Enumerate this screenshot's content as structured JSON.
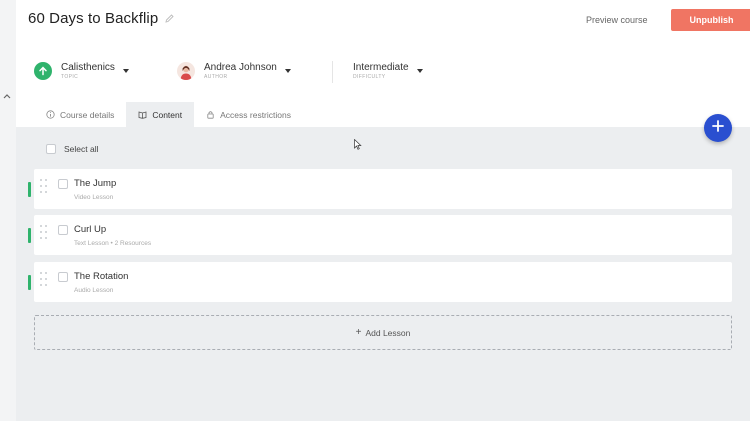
{
  "header": {
    "title": "60 Days to Backflip",
    "preview_label": "Preview course",
    "unpublish_label": "Unpublish"
  },
  "meta": {
    "topic": {
      "value": "Calisthenics",
      "label": "TOPIC"
    },
    "author": {
      "value": "Andrea Johnson",
      "label": "AUTHOR"
    },
    "difficulty": {
      "value": "Intermediate",
      "label": "DIFFICULTY"
    }
  },
  "tabs": [
    {
      "label": "Course details",
      "icon": "info-icon",
      "active": false
    },
    {
      "label": "Content",
      "icon": "book-icon",
      "active": true
    },
    {
      "label": "Access restrictions",
      "icon": "lock-icon",
      "active": false
    }
  ],
  "content": {
    "select_all_label": "Select all",
    "lessons": [
      {
        "title": "The Jump",
        "subtitle": "Video Lesson"
      },
      {
        "title": "Curl Up",
        "subtitle": "Text Lesson • 2 Resources"
      },
      {
        "title": "The Rotation",
        "subtitle": "Audio Lesson"
      }
    ],
    "add_lesson_label": "Add Lesson"
  },
  "colors": {
    "accent_green": "#2fb36c",
    "unpublish_red": "#f07563",
    "fab_blue": "#2a4fd0",
    "content_bg": "#eceef0"
  }
}
